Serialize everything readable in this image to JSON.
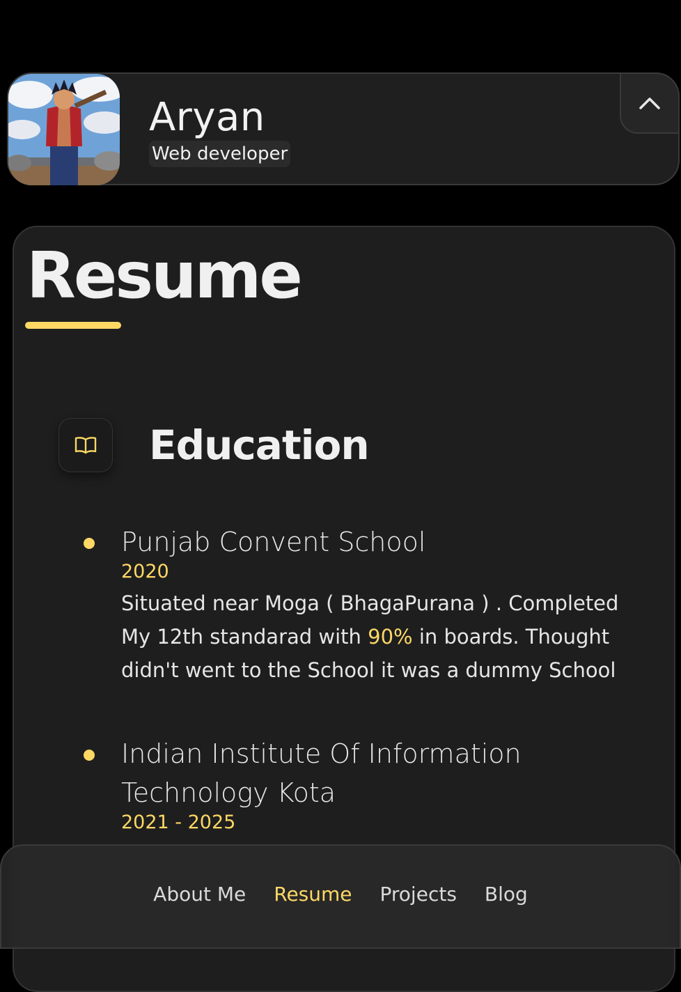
{
  "profile": {
    "name": "Aryan",
    "role": "Web developer"
  },
  "resume": {
    "title": "Resume",
    "section_title": "Education",
    "education": [
      {
        "school": "Punjab Convent School",
        "date": "2020",
        "desc_before": "Situated near Moga ( BhagaPurana ) . Completed My 12th standarad with ",
        "desc_highlight": "90%",
        "desc_after": " in boards. Thought didn't went to the School it was a dummy School"
      },
      {
        "school": "Indian Institute Of Information Technology Kota",
        "date": "2021 - 2025"
      }
    ]
  },
  "nav": {
    "items": [
      "About Me",
      "Resume",
      "Projects",
      "Blog"
    ],
    "active": "Resume"
  },
  "colors": {
    "accent": "#fdd865",
    "background": "#000000",
    "card": "#1e1e1e"
  },
  "icons": {
    "toggle": "chevron-up-icon",
    "education": "book-open-icon"
  }
}
